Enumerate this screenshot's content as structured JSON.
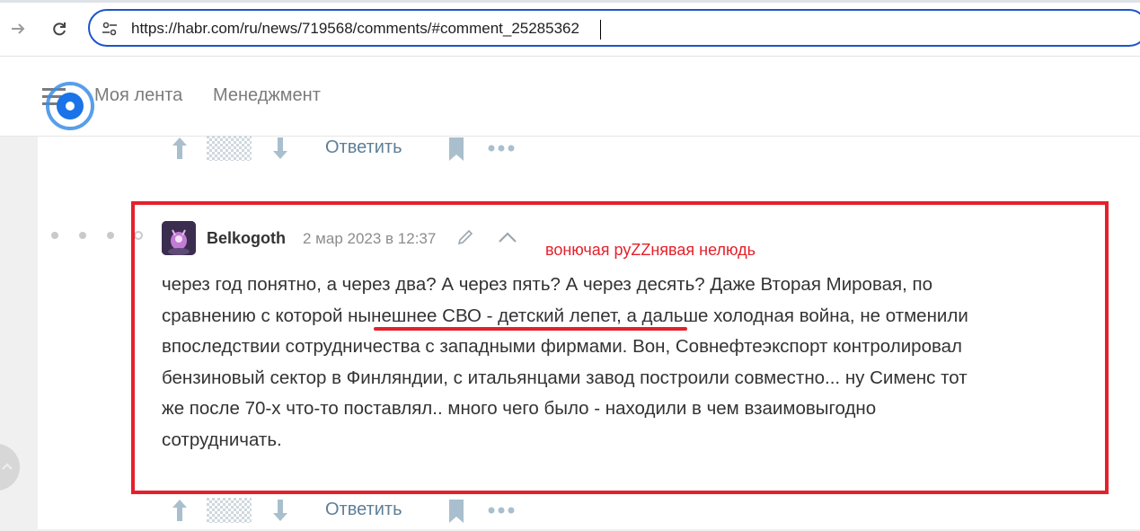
{
  "browser": {
    "url": "https://habr.com/ru/news/719568/comments/#comment_25285362"
  },
  "header": {
    "menu_items": [
      "Моя лента",
      "Менеджмент"
    ]
  },
  "comment": {
    "author": "Belkogoth",
    "date": "2 мар 2023 в 12:37",
    "body_lines": [
      "через год понятно, а через два? А через пять? А через десять? Даже Вторая Мировая, по",
      "сравнению с которой нынешнее СВО - детский лепет, а дальше холодная война, не отменили",
      "впоследствии сотрудничества с западными фирмами. Вон, Совнефтеэкспорт контролировал",
      "бензиновый сектор в Финляндии, с итальянцами завод построили совместно... ну Сименс тот",
      "же после 70-х что-то поставлял.. много чего было - находили в чем взаимовыгодно",
      "сотрудничать."
    ]
  },
  "annotation": {
    "text": "вонючая руZZнявая нелюдь",
    "color": "#e4212b"
  },
  "actions": {
    "reply_label": "Ответить"
  },
  "colors": {
    "accent_blue": "#1a56c9",
    "link_gray_blue": "#5e7f97",
    "annotation_red": "#e4212b"
  }
}
